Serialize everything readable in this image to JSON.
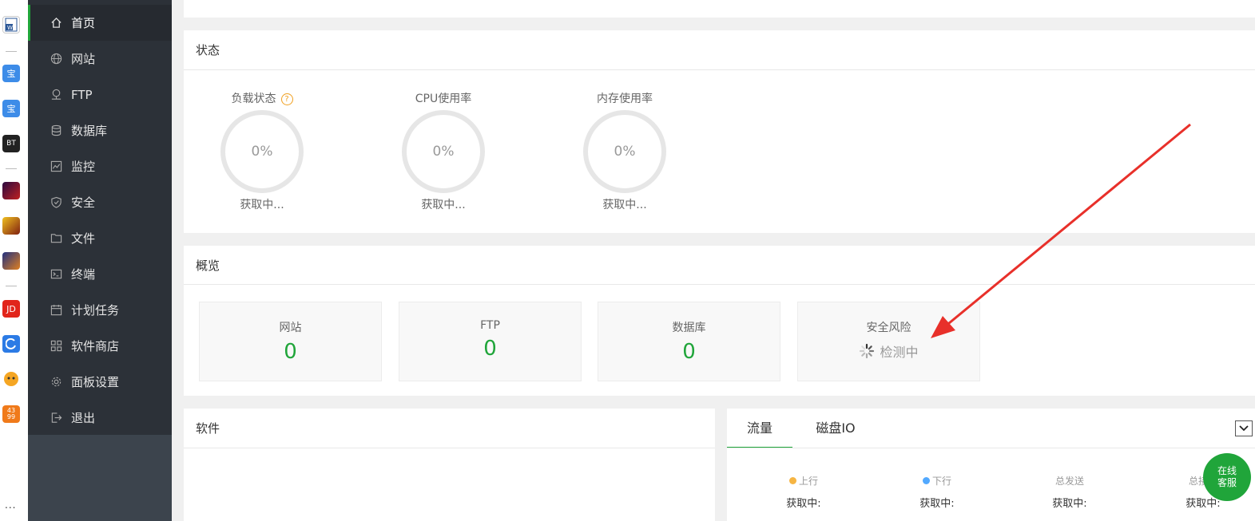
{
  "dock": {
    "icons": [
      {
        "name": "word-app-icon",
        "label": "",
        "color": "#2b5797"
      },
      {
        "name": "bao-app-icon-1",
        "label": "宝",
        "color": "#3d8ce8"
      },
      {
        "name": "bao-app-icon-2",
        "label": "宝",
        "color": "#3d8ce8"
      },
      {
        "name": "bt-app-icon",
        "label": "BT",
        "color": "#222222"
      },
      {
        "name": "game-app-icon-1",
        "label": "",
        "color": "#6a1a1a"
      },
      {
        "name": "game-app-icon-2",
        "label": "",
        "color": "#b06010"
      },
      {
        "name": "game-app-icon-3",
        "label": "",
        "color": "#4a2a70"
      },
      {
        "name": "jd-app-icon",
        "label": "JD",
        "color": "#e1251b"
      },
      {
        "name": "dolphin-app-icon",
        "label": "",
        "color": "#2c7be5"
      },
      {
        "name": "tiger-app-icon",
        "label": "",
        "color": "#f5a623"
      },
      {
        "name": "4399-app-icon",
        "label": "43 99",
        "color": "#f07a1a"
      }
    ],
    "more": "..."
  },
  "sidebar": {
    "items": [
      {
        "label": "首页",
        "icon": "home-icon",
        "active": true
      },
      {
        "label": "网站",
        "icon": "globe-icon"
      },
      {
        "label": "FTP",
        "icon": "ftp-icon"
      },
      {
        "label": "数据库",
        "icon": "database-icon"
      },
      {
        "label": "监控",
        "icon": "monitor-icon"
      },
      {
        "label": "安全",
        "icon": "shield-icon"
      },
      {
        "label": "文件",
        "icon": "folder-icon"
      },
      {
        "label": "终端",
        "icon": "terminal-icon"
      },
      {
        "label": "计划任务",
        "icon": "calendar-icon"
      },
      {
        "label": "软件商店",
        "icon": "apps-icon"
      },
      {
        "label": "面板设置",
        "icon": "gear-icon"
      },
      {
        "label": "退出",
        "icon": "logout-icon"
      }
    ]
  },
  "status": {
    "title": "状态",
    "gauges": [
      {
        "label": "负载状态",
        "value": "0%",
        "status": "获取中...",
        "help": "?"
      },
      {
        "label": "CPU使用率",
        "value": "0%",
        "status": "获取中..."
      },
      {
        "label": "内存使用率",
        "value": "0%",
        "status": "获取中..."
      }
    ]
  },
  "overview": {
    "title": "概览",
    "boxes": [
      {
        "label": "网站",
        "value": "0"
      },
      {
        "label": "FTP",
        "value": "0"
      },
      {
        "label": "数据库",
        "value": "0"
      },
      {
        "label": "安全风险",
        "checking": "检测中"
      }
    ]
  },
  "software": {
    "title": "软件"
  },
  "traffic": {
    "tabs": [
      "流量",
      "磁盘IO"
    ],
    "items": [
      {
        "label": "上行",
        "value": "获取中:",
        "dot": "#f6b543"
      },
      {
        "label": "下行",
        "value": "获取中:",
        "dot": "#52a9ff"
      },
      {
        "label": "总发送",
        "value": "获取中:"
      },
      {
        "label": "总接收",
        "value": "获取中:"
      }
    ]
  },
  "chat": {
    "line1": "在线",
    "line2": "客服"
  },
  "colors": {
    "accent": "#20a53a",
    "sidebar": "#2c3138",
    "arrow": "#e8302a"
  }
}
